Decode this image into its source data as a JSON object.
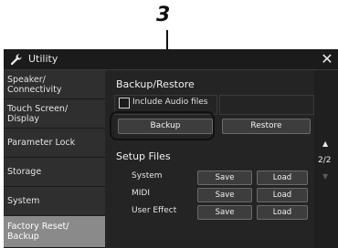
{
  "callout": {
    "number": "3"
  },
  "window": {
    "title": "Utility",
    "title_icon": "wrench-icon",
    "close_icon": "close-icon"
  },
  "sidebar": {
    "items": [
      {
        "label": "Speaker/\nConnectivity",
        "active": false
      },
      {
        "label": "Touch Screen/\nDisplay",
        "active": false
      },
      {
        "label": "Parameter Lock",
        "active": false
      },
      {
        "label": "Storage",
        "active": false
      },
      {
        "label": "System",
        "active": false
      },
      {
        "label": "Factory Reset/\nBackup",
        "active": true
      }
    ]
  },
  "backup_restore": {
    "title": "Backup/Restore",
    "include_audio_label": "Include Audio files",
    "include_audio_checked": false,
    "backup_label": "Backup",
    "restore_label": "Restore"
  },
  "setup_files": {
    "title": "Setup Files",
    "rows": [
      {
        "label": "System",
        "save": "Save",
        "load": "Load"
      },
      {
        "label": "MIDI",
        "save": "Save",
        "load": "Load"
      },
      {
        "label": "User Effect",
        "save": "Save",
        "load": "Load"
      }
    ]
  },
  "pager": {
    "up_icon": "triangle-up-icon",
    "page": "2/2",
    "down_icon": "triangle-down-icon"
  }
}
